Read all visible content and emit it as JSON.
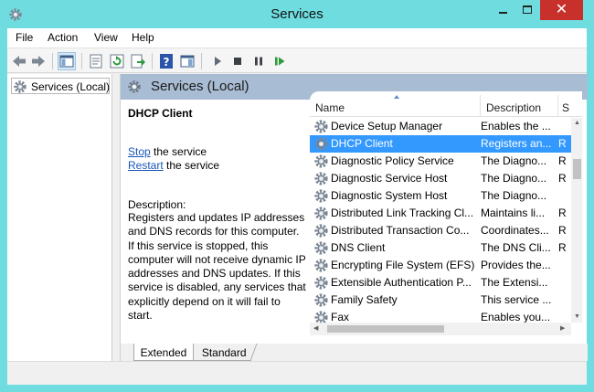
{
  "window": {
    "title": "Services"
  },
  "menu": [
    "File",
    "Action",
    "View",
    "Help"
  ],
  "toolbar": {
    "buttons": [
      "back-icon",
      "forward-icon",
      "show-hide-console-tree-icon",
      "properties-icon",
      "refresh-icon",
      "export-list-icon",
      "help-icon",
      "show-hide-action-pane-icon",
      "start-service-icon",
      "stop-service-icon",
      "pause-service-icon",
      "restart-service-icon"
    ]
  },
  "tree": {
    "root_label": "Services (Local)"
  },
  "main": {
    "header_title": "Services (Local)",
    "selected_service": "DHCP Client",
    "stop_link": "Stop",
    "stop_suffix": " the service",
    "restart_link": "Restart",
    "restart_suffix": " the service",
    "description_label": "Description:",
    "description_text": "Registers and updates IP addresses and DNS records for this computer. If this service is stopped, this computer will not receive dynamic IP addresses and DNS updates. If this service is disabled, any services that explicitly depend on it will fail to start."
  },
  "list": {
    "columns": [
      "Name",
      "Description",
      "S"
    ],
    "rows": [
      {
        "name": "Device Setup Manager",
        "description": "Enables the ...",
        "status": ""
      },
      {
        "name": "DHCP Client",
        "description": "Registers an...",
        "status": "R"
      },
      {
        "name": "Diagnostic Policy Service",
        "description": "The Diagno...",
        "status": "R"
      },
      {
        "name": "Diagnostic Service Host",
        "description": "The Diagno...",
        "status": "R"
      },
      {
        "name": "Diagnostic System Host",
        "description": "The Diagno...",
        "status": ""
      },
      {
        "name": "Distributed Link Tracking Cl...",
        "description": "Maintains li...",
        "status": "R"
      },
      {
        "name": "Distributed Transaction Co...",
        "description": "Coordinates...",
        "status": "R"
      },
      {
        "name": "DNS Client",
        "description": "The DNS Cli...",
        "status": "R"
      },
      {
        "name": "Encrypting File System (EFS)",
        "description": "Provides the...",
        "status": ""
      },
      {
        "name": "Extensible Authentication P...",
        "description": "The Extensi...",
        "status": ""
      },
      {
        "name": "Family Safety",
        "description": "This service ...",
        "status": ""
      },
      {
        "name": "Fax",
        "description": "Enables you...",
        "status": ""
      }
    ],
    "selected_index": 1
  },
  "tabs": [
    "Extended",
    "Standard"
  ],
  "colors": {
    "title_bar": "#6fdde0",
    "selection": "#3399ff",
    "header_band": "#a8bcd3",
    "link": "#1a56b8",
    "close_button": "#c7302b"
  }
}
